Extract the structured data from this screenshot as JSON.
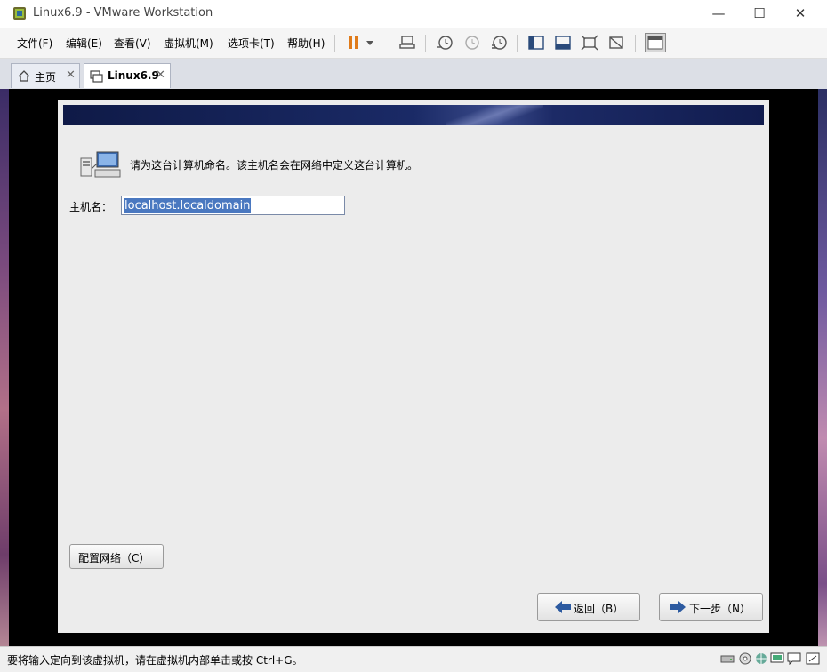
{
  "window": {
    "title": "Linux6.9 - VMware Workstation",
    "minimize": "—",
    "maximize": "☐",
    "close": "✕"
  },
  "menu": {
    "items": [
      "文件(F)",
      "编辑(E)",
      "查看(V)",
      "虚拟机(M)",
      "选项卡(T)",
      "帮助(H)"
    ]
  },
  "tabs": [
    {
      "label": "主页",
      "icon": "home-icon"
    },
    {
      "label": "Linux6.9",
      "icon": "vm-icon"
    }
  ],
  "installer": {
    "prompt": "请为这台计算机命名。该主机名会在网络中定义这台计算机。",
    "hostname_label": "主机名：",
    "hostname_value": "localhost.localdomain",
    "configure_network_button": "配置网络（C）",
    "back_button": "返回（B）",
    "next_button": "下一步（N）"
  },
  "status": {
    "text": "要将输入定向到该虚拟机，请在虚拟机内部单击或按 Ctrl+G。"
  },
  "colors": {
    "banner": "#1a2a66",
    "selection": "#4a78c0",
    "pause_icon": "#e07b1a"
  }
}
